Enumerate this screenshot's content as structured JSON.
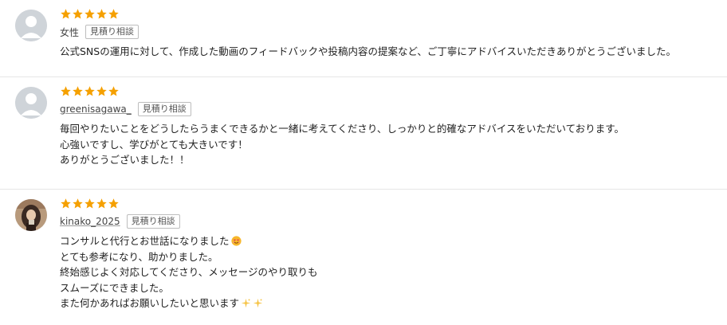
{
  "colors": {
    "star": "#f5a000",
    "avatar_bg": "#cfd4d9",
    "avatar_fg": "#ffffff"
  },
  "reviews": [
    {
      "rating": 5,
      "reviewer": "女性",
      "badge": "見積り相談",
      "avatar": "default-avatar-icon",
      "lines": [
        "公式SNSの運用に対して、作成した動画のフィードバックや投稿内容の提案など、ご丁寧にアドバイスいただきありがとうございました。"
      ]
    },
    {
      "rating": 5,
      "reviewer": "greenisagawa_",
      "badge": "見積り相談",
      "avatar": "default-avatar-icon",
      "lines": [
        "毎回やりたいことをどうしたらうまくできるかと一緒に考えてくださり、しっかりと的確なアドバイスをいただいております。",
        "心強いですし、学びがとても大きいです！",
        "ありがとうございました！！"
      ]
    },
    {
      "rating": 5,
      "reviewer": "kinako_2025",
      "badge": "見積り相談",
      "avatar": "user-photo-avatar",
      "lines": [
        "コンサルと代行とお世話になりました",
        "とても参考になり、助かりました。",
        "終始感じよく対応してくださり、メッセージのやり取りも",
        "スムーズにできました。",
        "また何かあればお願いしたいと思います"
      ],
      "emojis": [
        "smiling-face-with-hearts-emoji",
        "sparkles-emoji"
      ]
    }
  ]
}
